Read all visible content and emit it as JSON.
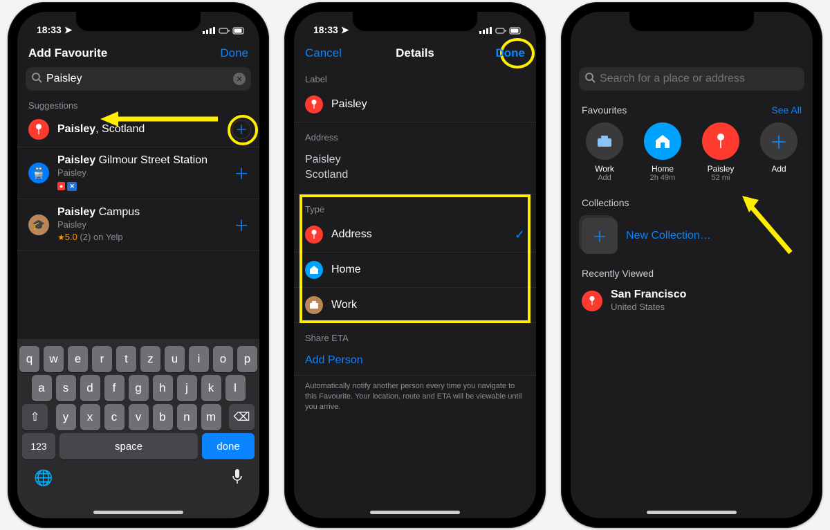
{
  "status": {
    "time": "18:33",
    "location_icon": "➤"
  },
  "screen1": {
    "title": "Add Favourite",
    "done": "Done",
    "search_value": "Paisley",
    "suggestions_label": "Suggestions",
    "items": [
      {
        "bold": "Paisley",
        "rest": ", Scotland"
      },
      {
        "bold": "Paisley",
        "rest": " Gilmour Street Station",
        "sub": "Paisley"
      },
      {
        "bold": "Paisley",
        "rest": " Campus",
        "sub": "Paisley",
        "rating": "5.0",
        "count": "(2)",
        "yelp": "on Yelp"
      }
    ],
    "keyboard": {
      "rows": [
        [
          "q",
          "w",
          "e",
          "r",
          "t",
          "z",
          "u",
          "i",
          "o",
          "p"
        ],
        [
          "a",
          "s",
          "d",
          "f",
          "g",
          "h",
          "j",
          "k",
          "l"
        ]
      ],
      "shift": "⇧",
      "delete": "⌫",
      "row3": [
        "y",
        "x",
        "c",
        "v",
        "b",
        "n",
        "m"
      ],
      "num": "123",
      "space": "space",
      "done": "done"
    }
  },
  "screen2": {
    "cancel": "Cancel",
    "title": "Details",
    "done": "Done",
    "label_head": "Label",
    "label_value": "Paisley",
    "address_head": "Address",
    "address_line1": "Paisley",
    "address_line2": "Scotland",
    "type_head": "Type",
    "types": [
      {
        "name": "Address",
        "color": "#ff3b30",
        "checked": true
      },
      {
        "name": "Home",
        "color": "#00a2ff"
      },
      {
        "name": "Work",
        "color": "#ba865a"
      }
    ],
    "share_head": "Share ETA",
    "add_person": "Add Person",
    "footnote": "Automatically notify another person every time you navigate to this Favourite. Your location, route and ETA will be viewable until you arrive."
  },
  "screen3": {
    "search_placeholder": "Search for a place or address",
    "fav_title": "Favourites",
    "see_all": "See All",
    "favs": [
      {
        "name": "Work",
        "sub": "Add",
        "color": "#3a3a3c",
        "glyph": "briefcase"
      },
      {
        "name": "Home",
        "sub": "2h 49m",
        "color": "#00a2ff",
        "glyph": "house"
      },
      {
        "name": "Paisley",
        "sub": "52 mi",
        "color": "#ff3b30",
        "glyph": "pin"
      },
      {
        "name": "Add",
        "sub": "",
        "color": "#3a3a3c",
        "glyph": "plus"
      }
    ],
    "coll_title": "Collections",
    "new_collection": "New Collection…",
    "recent_title": "Recently Viewed",
    "recent": {
      "name": "San Francisco",
      "sub": "United States"
    }
  }
}
